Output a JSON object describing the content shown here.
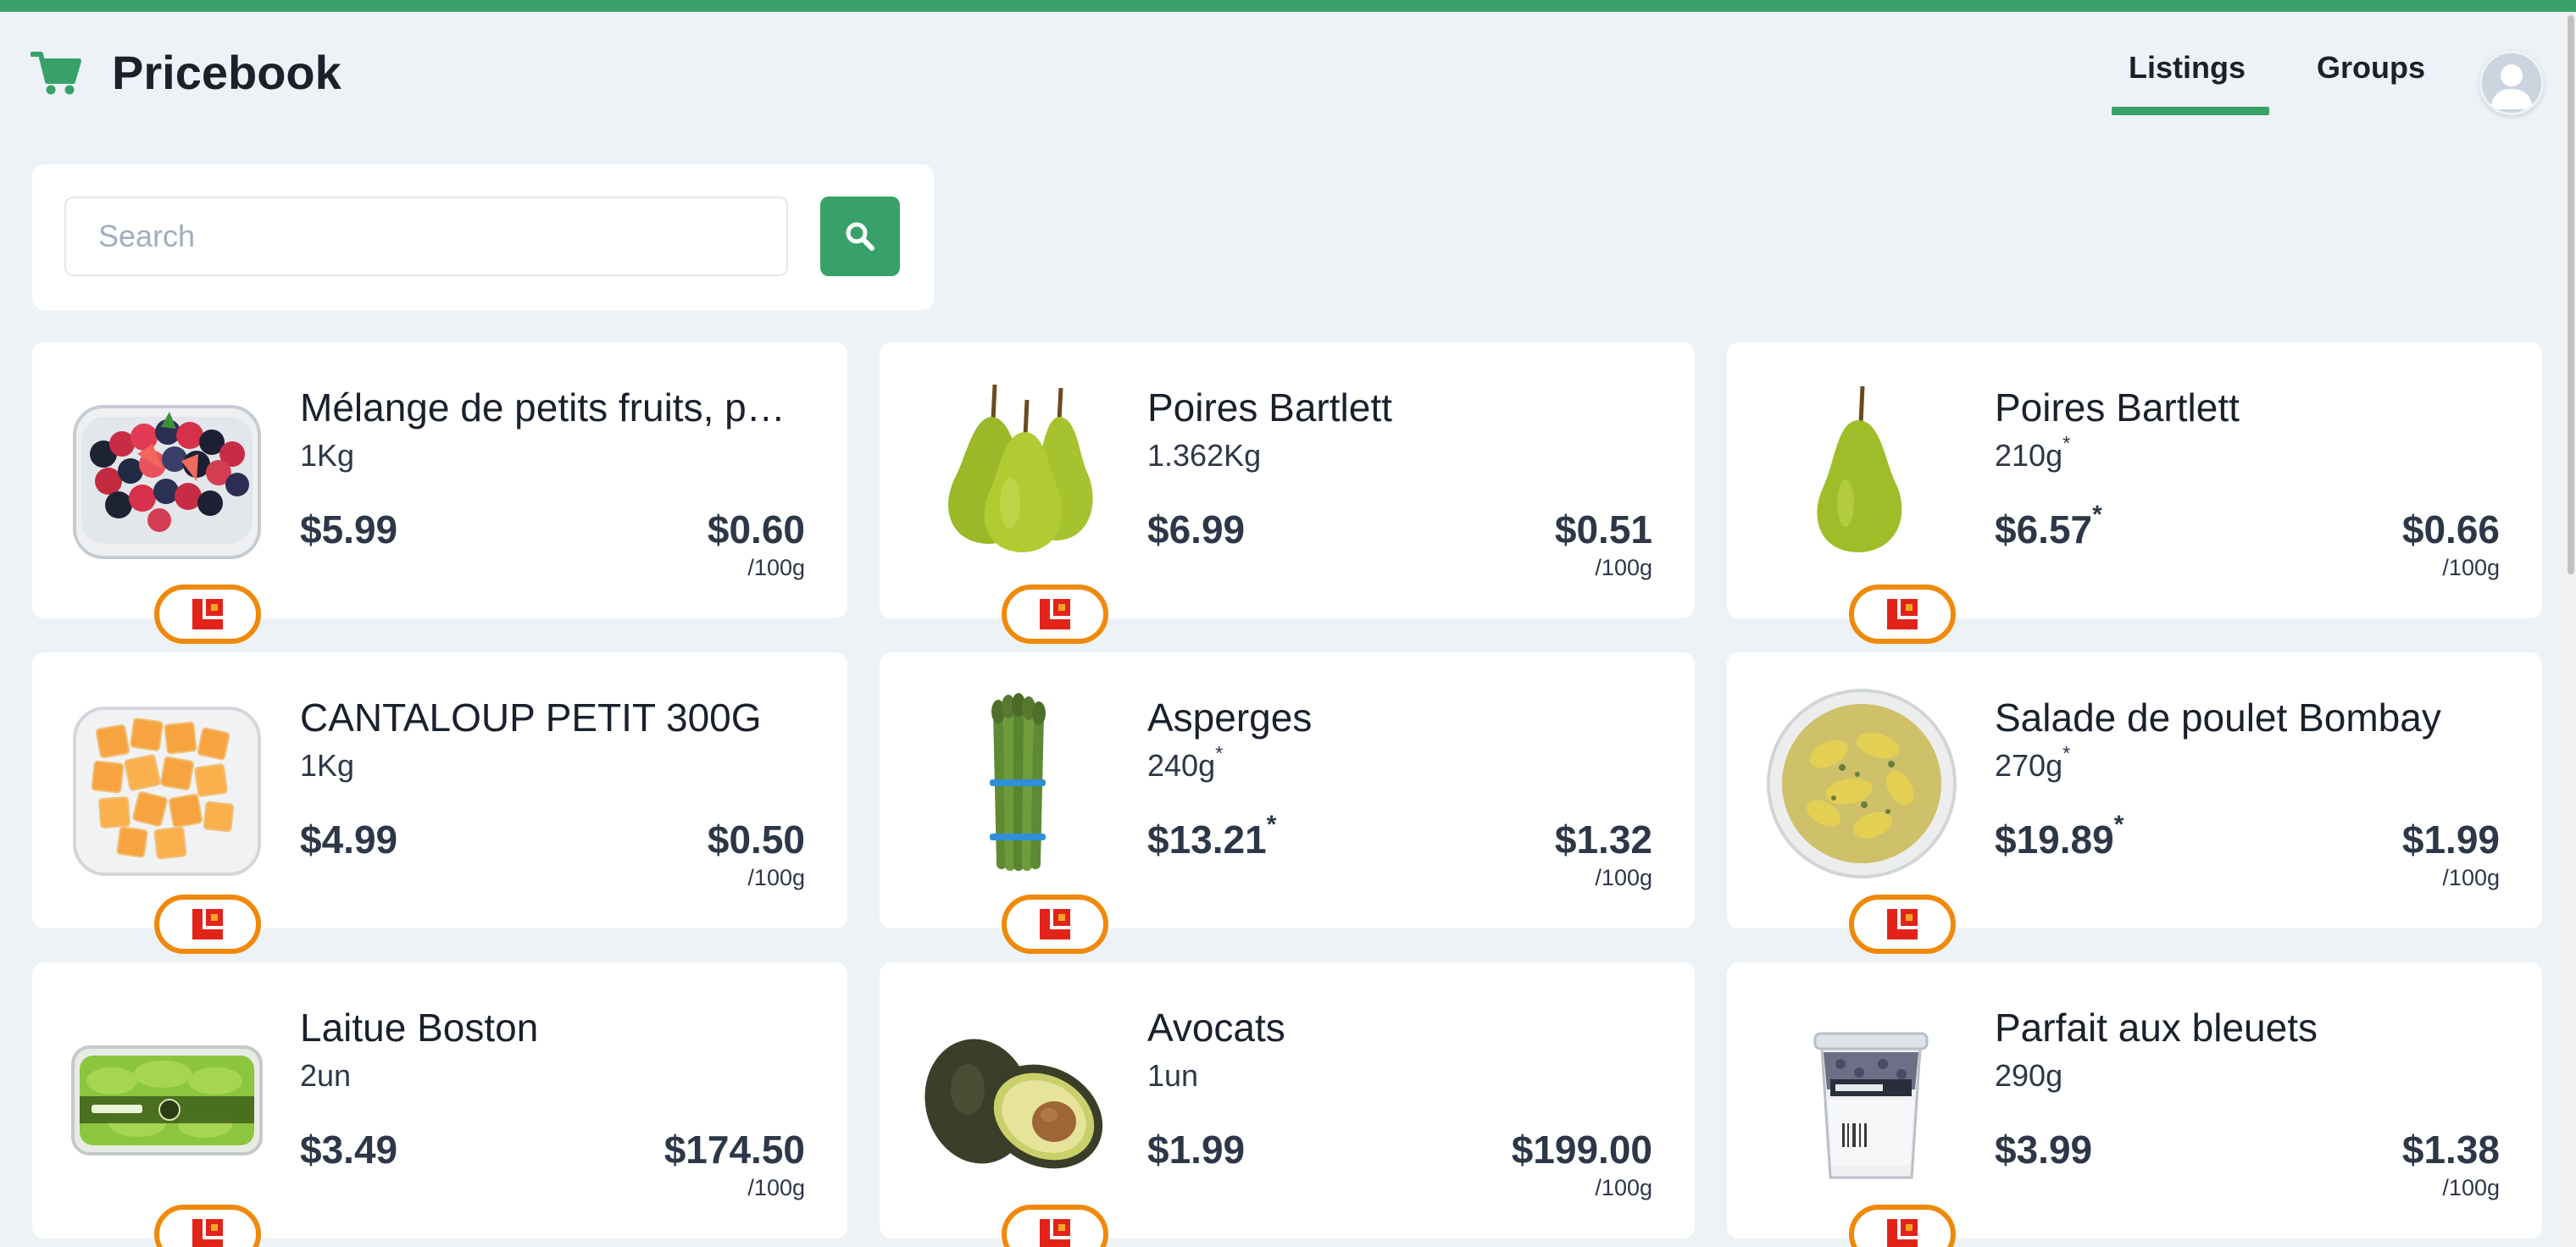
{
  "app": {
    "title": "Pricebook",
    "icon": "shopping-cart-icon",
    "accent_color": "#38a169"
  },
  "nav": {
    "tabs": [
      {
        "label": "Listings",
        "active": true
      },
      {
        "label": "Groups",
        "active": false
      }
    ],
    "avatar_icon": "user-avatar-icon"
  },
  "search": {
    "placeholder": "Search",
    "value": "",
    "button_icon": "search-icon"
  },
  "store_badge": {
    "icon": "loblaws-logo-icon",
    "border_color": "#f0890a",
    "logo_color": "#e2231a"
  },
  "listings": [
    {
      "name": "Mélange de petits fruits, p…",
      "size": "1Kg",
      "size_estimated": false,
      "price": "$5.99",
      "price_estimated": false,
      "unit_price": "$0.60",
      "unit_label": "/100g",
      "image_icon": "mixed-berries-icon"
    },
    {
      "name": "Poires Bartlett",
      "size": "1.362Kg",
      "size_estimated": false,
      "price": "$6.99",
      "price_estimated": false,
      "unit_price": "$0.51",
      "unit_label": "/100g",
      "image_icon": "pears-bunch-icon"
    },
    {
      "name": "Poires Bartlett",
      "size": "210g",
      "size_estimated": true,
      "price": "$6.57",
      "price_estimated": true,
      "unit_price": "$0.66",
      "unit_label": "/100g",
      "image_icon": "single-pear-icon"
    },
    {
      "name": "CANTALOUP PETIT 300G",
      "size": "1Kg",
      "size_estimated": false,
      "price": "$4.99",
      "price_estimated": false,
      "unit_price": "$0.50",
      "unit_label": "/100g",
      "image_icon": "cantaloupe-cubes-icon"
    },
    {
      "name": "Asperges",
      "size": "240g",
      "size_estimated": true,
      "price": "$13.21",
      "price_estimated": true,
      "unit_price": "$1.32",
      "unit_label": "/100g",
      "image_icon": "asparagus-bunch-icon"
    },
    {
      "name": "Salade de poulet Bombay",
      "size": "270g",
      "size_estimated": true,
      "price": "$19.89",
      "price_estimated": true,
      "unit_price": "$1.99",
      "unit_label": "/100g",
      "image_icon": "chicken-salad-bowl-icon"
    },
    {
      "name": "Laitue Boston",
      "size": "2un",
      "size_estimated": false,
      "price": "$3.49",
      "price_estimated": false,
      "unit_price": "$174.50",
      "unit_label": "/100g",
      "image_icon": "boston-lettuce-pack-icon"
    },
    {
      "name": "Avocats",
      "size": "1un",
      "size_estimated": false,
      "price": "$1.99",
      "price_estimated": false,
      "unit_price": "$199.00",
      "unit_label": "/100g",
      "image_icon": "avocados-icon"
    },
    {
      "name": "Parfait aux bleuets",
      "size": "290g",
      "size_estimated": false,
      "price": "$3.99",
      "price_estimated": false,
      "unit_price": "$1.38",
      "unit_label": "/100g",
      "image_icon": "blueberry-parfait-cup-icon"
    }
  ]
}
